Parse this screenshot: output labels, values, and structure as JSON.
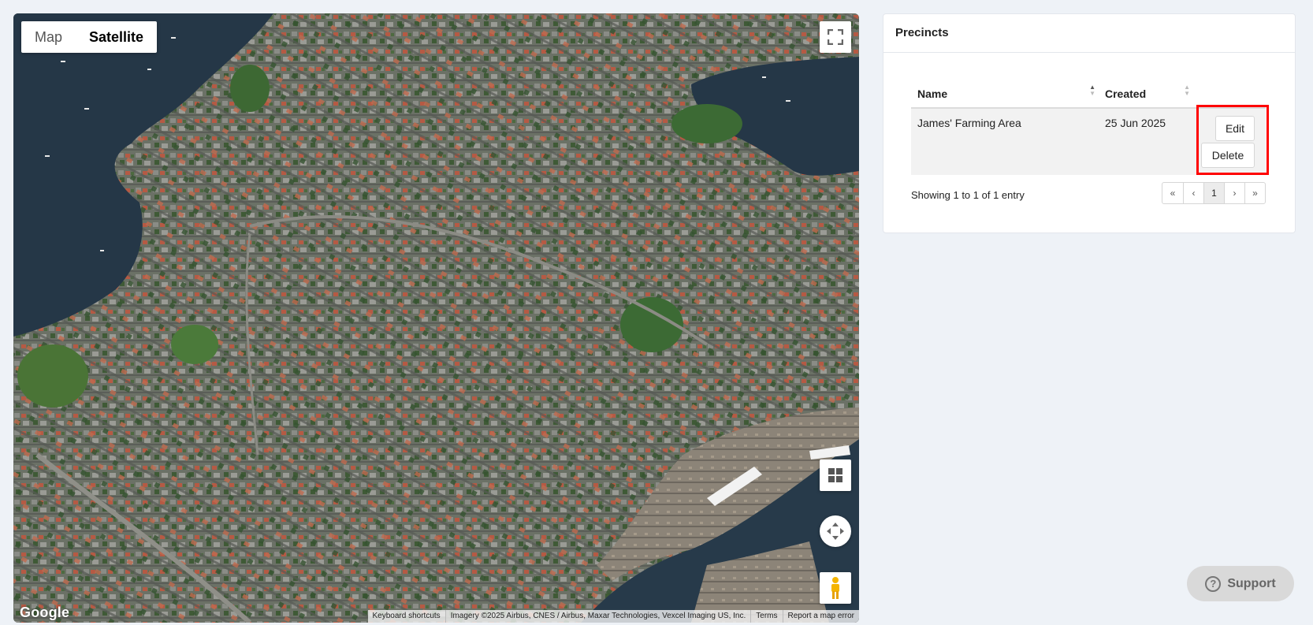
{
  "map": {
    "type_options": [
      "Map",
      "Satellite"
    ],
    "active_type": "Satellite",
    "logo": "Google",
    "attribution": [
      "Keyboard shortcuts",
      "Imagery ©2025 Airbus, CNES / Airbus, Maxar Technologies, Vexcel Imaging US, Inc.",
      "Terms",
      "Report a map error"
    ],
    "controls": [
      "fullscreen-icon",
      "layers-icon",
      "rotate-icon",
      "pegman-icon"
    ]
  },
  "panel": {
    "title": "Precincts",
    "columns": {
      "name": "Name",
      "created": "Created"
    },
    "rows": [
      {
        "name": "James' Farming Area",
        "created": "25 Jun 2025",
        "edit": "Edit",
        "delete": "Delete"
      }
    ],
    "info": "Showing 1 to 1 of 1 entry",
    "pager": [
      "«",
      "‹",
      "1",
      "›",
      "»"
    ],
    "current_page": "1"
  },
  "support": {
    "label": "Support"
  },
  "colors": {
    "highlight": "#ff0000",
    "background": "#eef2f7",
    "water": "#2a3b4c"
  }
}
